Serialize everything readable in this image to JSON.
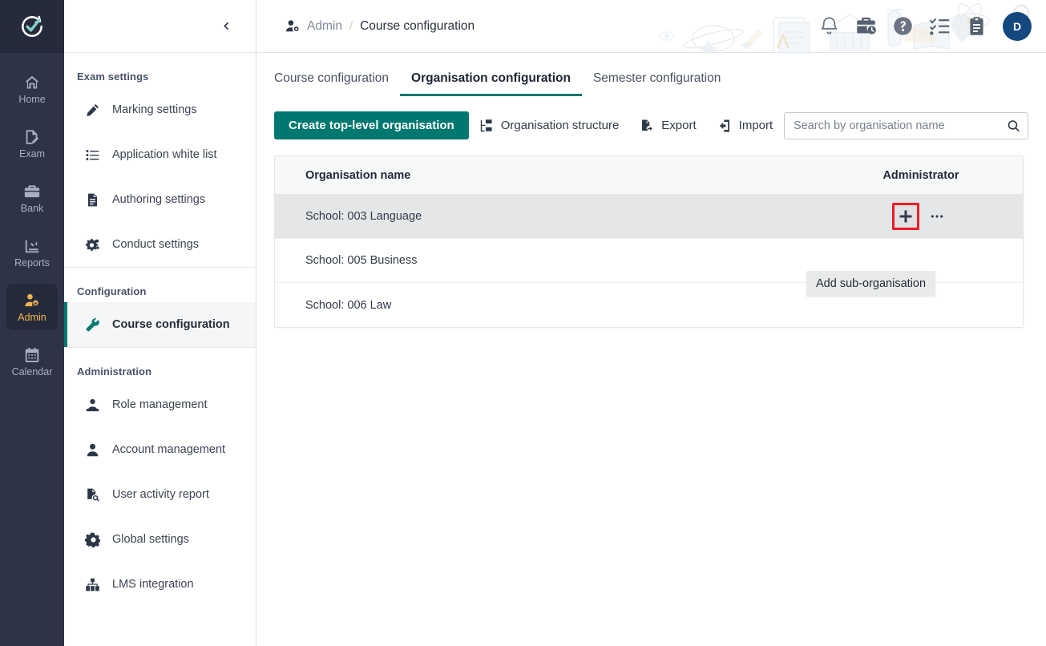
{
  "brand": {
    "logo_icon": "check-circle-arrow-logo",
    "accent_teal": "#00786f",
    "rail_bg": "#2e3448",
    "active_rail_color": "#f3b44f",
    "highlight_red": "#ee1c25",
    "avatar_bg": "#14487f"
  },
  "rail": {
    "items": [
      {
        "label": "Home",
        "icon": "home-icon",
        "active": false
      },
      {
        "label": "Exam",
        "icon": "exam-icon",
        "active": false
      },
      {
        "label": "Bank",
        "icon": "bank-icon",
        "active": false
      },
      {
        "label": "Reports",
        "icon": "reports-icon",
        "active": false
      },
      {
        "label": "Admin",
        "icon": "admin-icon",
        "active": true
      },
      {
        "label": "Calendar",
        "icon": "calendar-icon",
        "active": false
      }
    ]
  },
  "sidebar": {
    "collapse_icon": "chevron-left-icon",
    "groups": [
      {
        "title": "Exam settings",
        "items": [
          {
            "label": "Marking settings",
            "icon": "pencil-icon",
            "active": false
          },
          {
            "label": "Application white list",
            "icon": "list-icon",
            "active": false
          },
          {
            "label": "Authoring settings",
            "icon": "document-icon",
            "active": false
          },
          {
            "label": "Conduct settings",
            "icon": "gears-icon",
            "active": false
          }
        ]
      },
      {
        "title": "Configuration",
        "items": [
          {
            "label": "Course configuration",
            "icon": "wrench-icon",
            "active": true
          }
        ]
      },
      {
        "title": "Administration",
        "items": [
          {
            "label": "Role management",
            "icon": "role-user-icon",
            "active": false
          },
          {
            "label": "Account management",
            "icon": "user-icon",
            "active": false
          },
          {
            "label": "User activity report",
            "icon": "document-search-icon",
            "active": false
          },
          {
            "label": "Global settings",
            "icon": "gear-icon",
            "active": false
          },
          {
            "label": "LMS integration",
            "icon": "lms-icon",
            "active": false
          }
        ]
      }
    ]
  },
  "topbar": {
    "breadcrumb_icon": "admin-user-icon",
    "breadcrumb_root": "Admin",
    "breadcrumb_separator": "/",
    "breadcrumb_current": "Course configuration",
    "icons": [
      {
        "name": "bell-icon"
      },
      {
        "name": "briefcase-clock-icon"
      },
      {
        "name": "help-circle-icon"
      },
      {
        "name": "checklist-icon"
      },
      {
        "name": "clipboard-icon"
      }
    ],
    "avatar_initial": "D"
  },
  "tabs": [
    {
      "label": "Course configuration",
      "active": false
    },
    {
      "label": "Organisation configuration",
      "active": true
    },
    {
      "label": "Semester configuration",
      "active": false
    }
  ],
  "toolbar": {
    "create_label": "Create top-level organisation",
    "structure_label": "Organisation structure",
    "structure_icon": "org-structure-icon",
    "export_label": "Export",
    "export_icon": "export-icon",
    "import_label": "Import",
    "import_icon": "import-icon"
  },
  "search": {
    "placeholder": "Search by organisation name",
    "value": "",
    "icon": "search-icon"
  },
  "table": {
    "columns": {
      "name": "Organisation name",
      "admin": "Administrator"
    },
    "rows": [
      {
        "name": "School: 003 Language",
        "hovered": true
      },
      {
        "name": "School: 005 Business",
        "hovered": false
      },
      {
        "name": "School: 006 Law",
        "hovered": false
      }
    ],
    "row_actions": {
      "add_icon": "plus-icon",
      "more_icon": "ellipsis-icon"
    }
  },
  "tooltip": {
    "text": "Add sub-organisation"
  }
}
